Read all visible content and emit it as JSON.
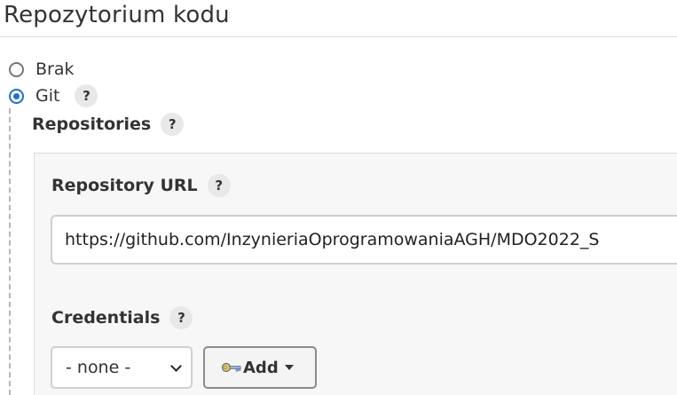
{
  "section": {
    "title": "Repozytorium kodu"
  },
  "scm_options": [
    {
      "label": "Brak",
      "selected": false
    },
    {
      "label": "Git",
      "selected": true
    }
  ],
  "help": {
    "symbol": "?"
  },
  "repositories": {
    "label": "Repositories",
    "url_label": "Repository URL",
    "url_value": "https://github.com/InzynieriaOprogramowaniaAGH/MDO2022_S",
    "credentials_label": "Credentials",
    "credentials_selected": "- none -",
    "add_label": "Add"
  },
  "colors": {
    "radio_selected": "#1a6fe0",
    "help_bg": "#e8e8e8"
  }
}
